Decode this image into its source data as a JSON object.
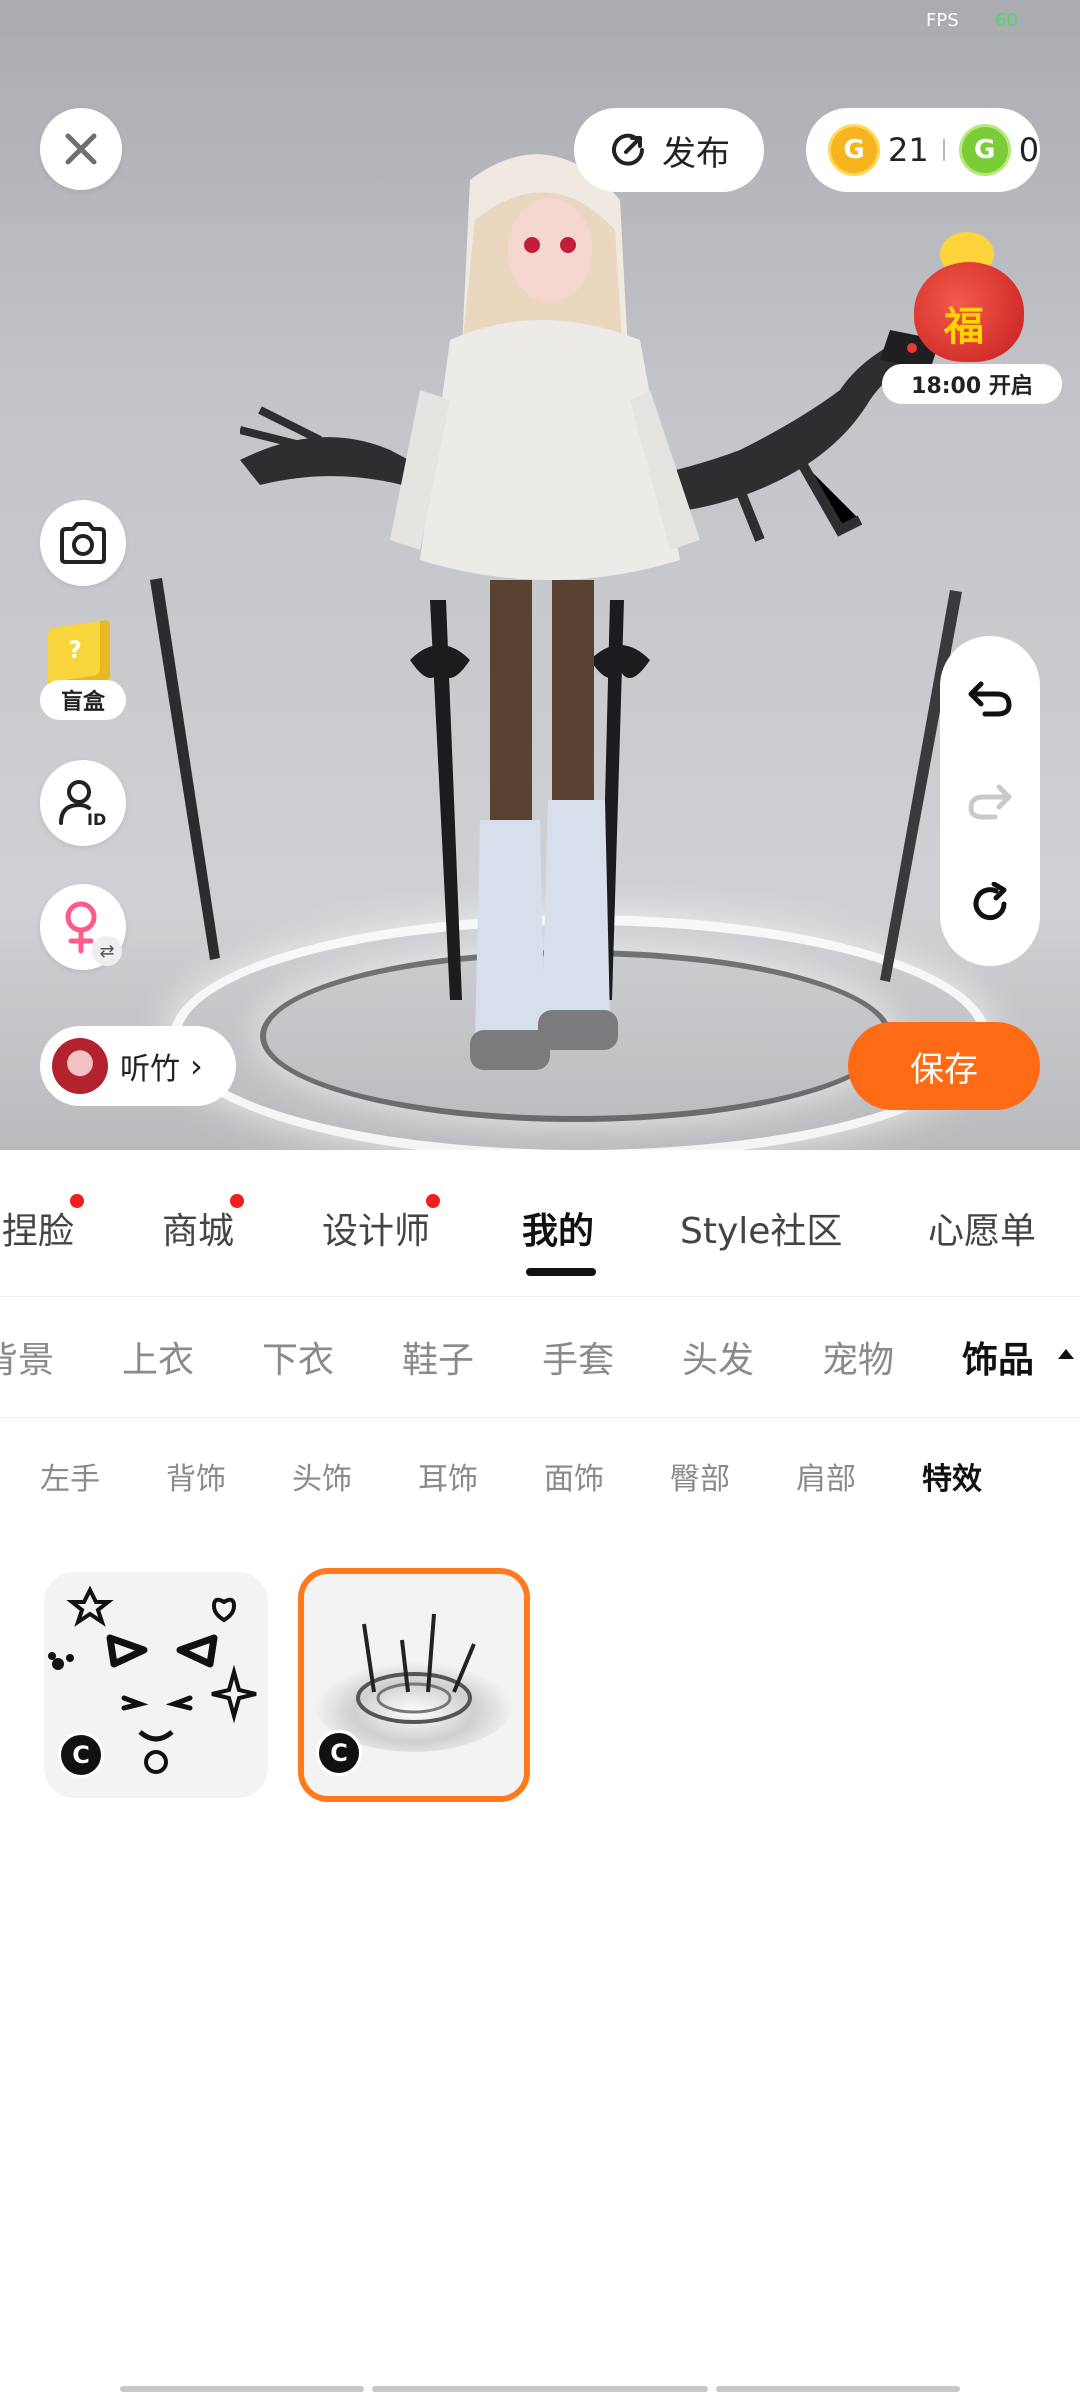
{
  "status": {
    "fps_label": "FPS",
    "fps_value": "60"
  },
  "top": {
    "publish_label": "发布",
    "coins": {
      "gold": "21",
      "green": "0"
    },
    "event_time": "18:00 开启",
    "event_char": "福"
  },
  "left_tools": {
    "blind_box_label": "盲盒"
  },
  "user": {
    "name": "听竹"
  },
  "save_label": "保存",
  "main_tabs": [
    {
      "label": "捏脸",
      "dot": true
    },
    {
      "label": "商城",
      "dot": true
    },
    {
      "label": "设计师",
      "dot": true
    },
    {
      "label": "我的",
      "dot": false,
      "active": true
    },
    {
      "label": "Style社区",
      "dot": false
    },
    {
      "label": "心愿单",
      "dot": false
    }
  ],
  "category_tabs": [
    "背景",
    "上衣",
    "下衣",
    "鞋子",
    "手套",
    "头发",
    "宠物",
    "饰品"
  ],
  "active_category": "饰品",
  "sub_tabs": [
    "左手",
    "背饰",
    "头饰",
    "耳饰",
    "面饰",
    "臀部",
    "肩部",
    "特效"
  ],
  "active_sub_tab": "特效",
  "items": [
    {
      "name": "cat-face-effect",
      "badge": "C",
      "selected": false
    },
    {
      "name": "sword-circle-effect",
      "badge": "C",
      "selected": true
    }
  ],
  "colors": {
    "accent": "#ff6a14",
    "tab_dot": "#f01f1f",
    "selected_border": "#ff7a1a"
  }
}
